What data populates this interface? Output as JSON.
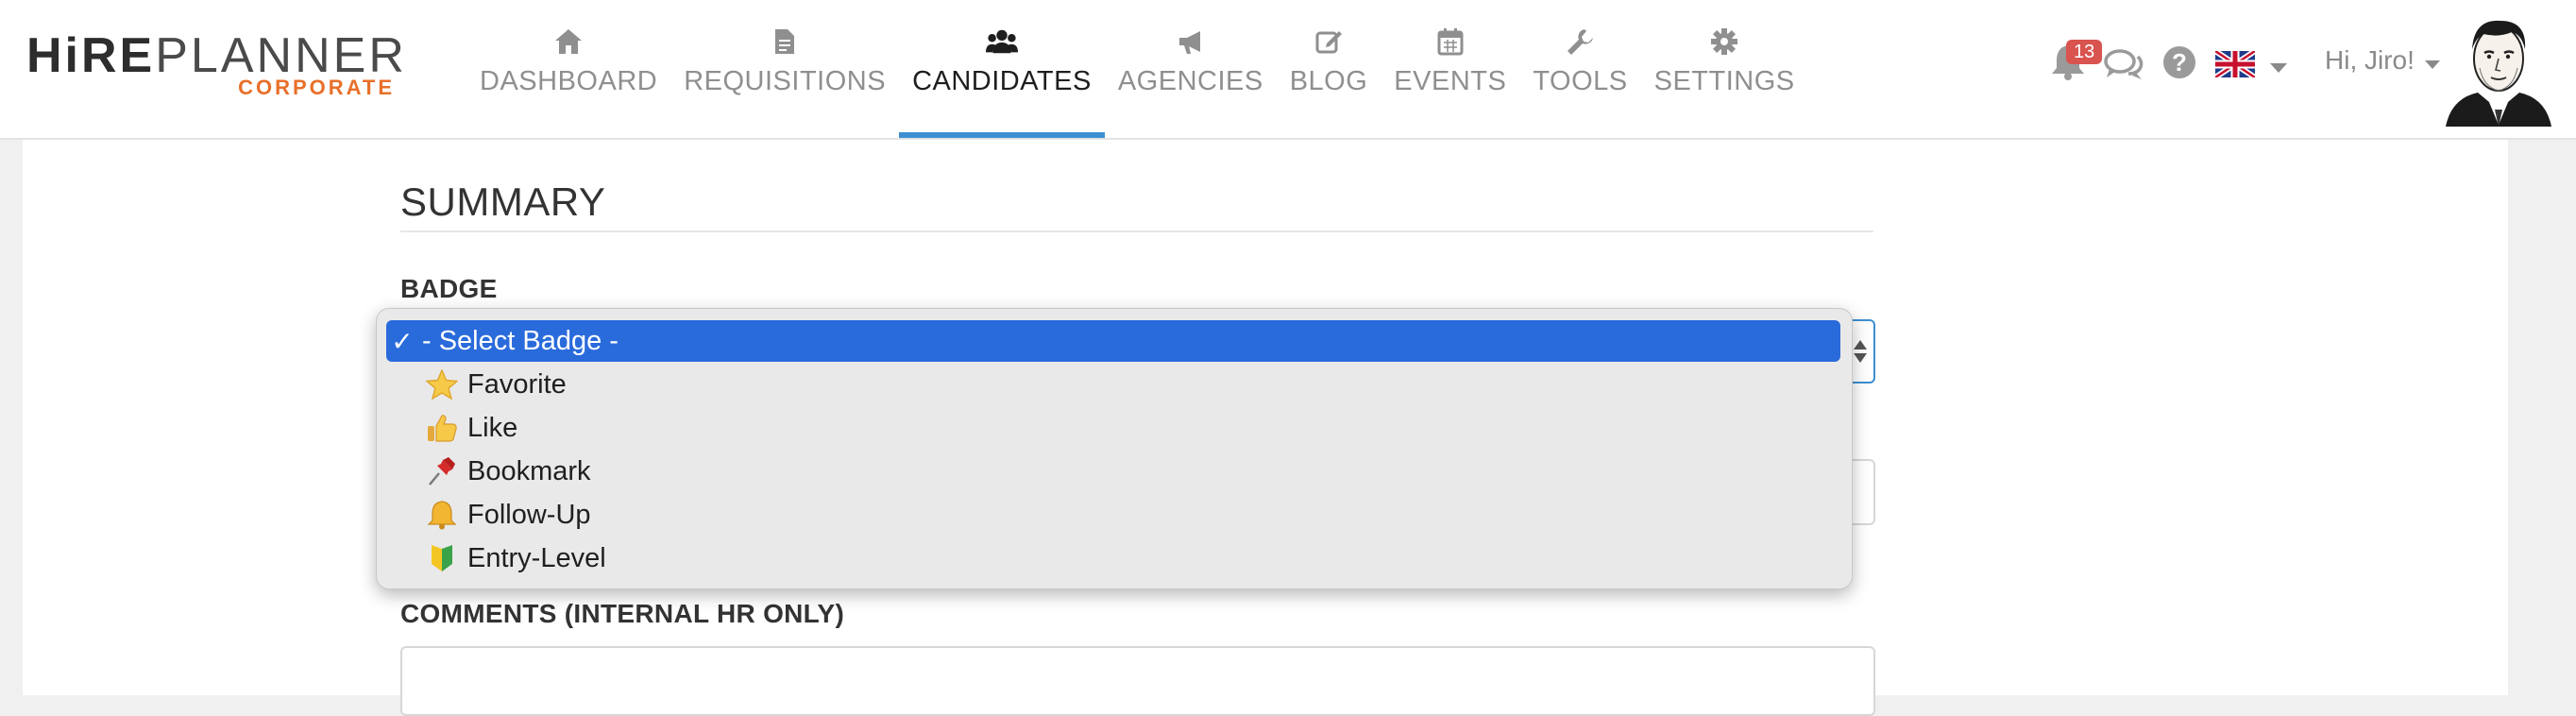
{
  "header": {
    "logo": {
      "hire": "HiRE",
      "planner": "PLANNER",
      "tagline": "CORPORATE"
    },
    "nav": [
      {
        "label": "DASHBOARD",
        "icon": "home-icon"
      },
      {
        "label": "REQUISITIONS",
        "icon": "document-icon"
      },
      {
        "label": "CANDIDATES",
        "icon": "users-icon",
        "active": true
      },
      {
        "label": "AGENCIES",
        "icon": "megaphone-icon"
      },
      {
        "label": "BLOG",
        "icon": "edit-icon"
      },
      {
        "label": "EVENTS",
        "icon": "calendar-icon"
      },
      {
        "label": "TOOLS",
        "icon": "wrench-icon"
      },
      {
        "label": "SETTINGS",
        "icon": "gear-icon"
      }
    ],
    "notifications_count": "13",
    "greeting": "Hi, Jiro!"
  },
  "summary": {
    "title": "SUMMARY",
    "badge_label": "BADGE",
    "comments_label": "COMMENTS (INTERNAL HR ONLY)"
  },
  "badge_dropdown": {
    "options": [
      {
        "label": "- Select Badge -",
        "icon": "checkmark-icon",
        "selected": true
      },
      {
        "label": "Favorite",
        "icon": "star-icon"
      },
      {
        "label": "Like",
        "icon": "thumbs-up-icon"
      },
      {
        "label": "Bookmark",
        "icon": "pushpin-icon"
      },
      {
        "label": "Follow-Up",
        "icon": "bell-icon"
      },
      {
        "label": "Entry-Level",
        "icon": "beginner-shield-icon"
      }
    ]
  },
  "colors": {
    "accent": "#3d8fd1",
    "logo_orange": "#e8702a",
    "selection": "#2a6bdc",
    "notification": "#d9534f"
  }
}
